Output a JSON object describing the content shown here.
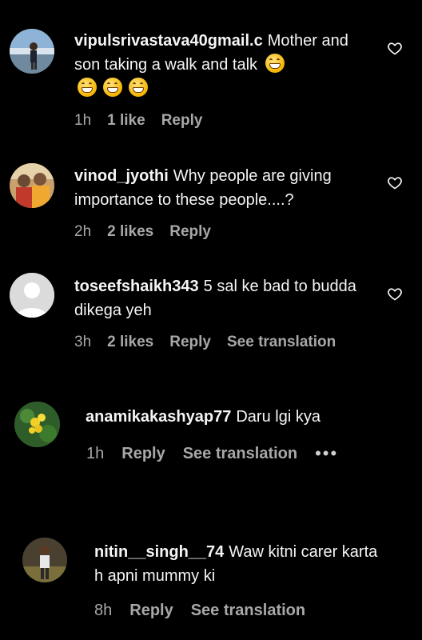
{
  "comments": [
    {
      "username": "vipulsrivastava40gmail.c",
      "text": "Mother and son taking a walk and talk",
      "time": "1h",
      "likes": "1 like",
      "reply": "Reply",
      "emoji_icon": "grinning-face-icon"
    },
    {
      "username": "vinod_jyothi",
      "text": "Why people are giving importance to these people....?",
      "time": "2h",
      "likes": "2 likes",
      "reply": "Reply"
    },
    {
      "username": "toseefshaikh343",
      "text": "5 sal ke bad to budda dikega yeh",
      "time": "3h",
      "likes": "2 likes",
      "reply": "Reply",
      "translate": "See translation"
    },
    {
      "username": "anamikakashyap77",
      "text": "Daru lgi kya",
      "time": "1h",
      "reply": "Reply",
      "translate": "See translation",
      "more": "•••"
    },
    {
      "username": "nitin__singh__74",
      "text": "Waw kitni carer karta h apni mummy ki",
      "time": "8h",
      "reply": "Reply",
      "translate": "See translation"
    }
  ],
  "colors": {
    "background": "#000000",
    "text": "#f5f5f5",
    "meta": "#a8a8a8"
  }
}
